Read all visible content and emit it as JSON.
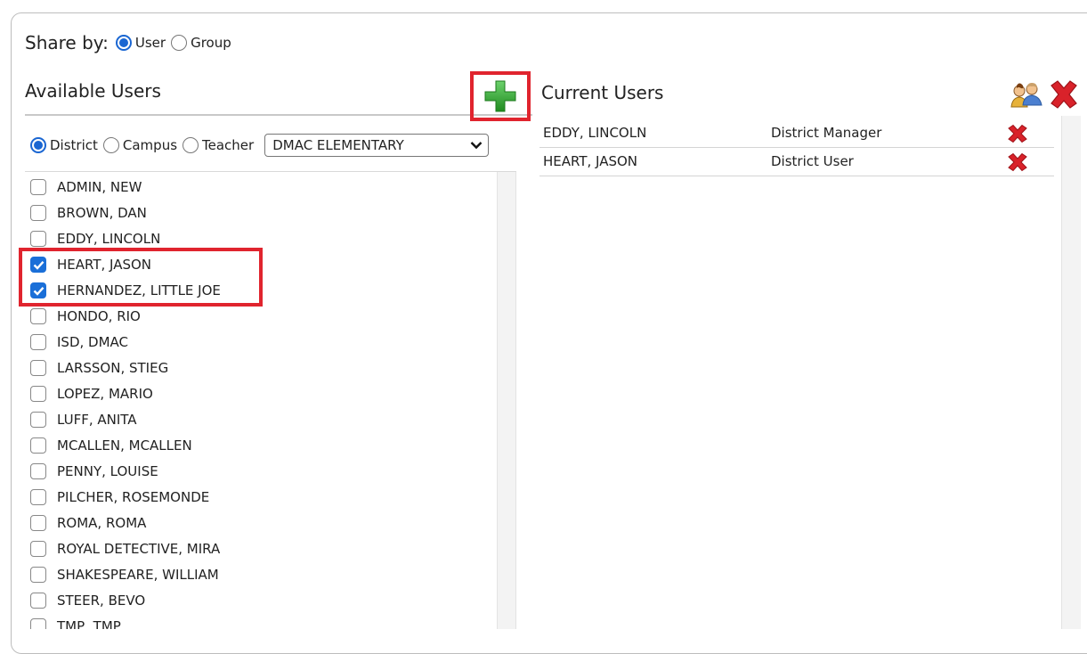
{
  "share": {
    "label": "Share by:",
    "options": [
      {
        "label": "User",
        "selected": true
      },
      {
        "label": "Group",
        "selected": false
      }
    ]
  },
  "available": {
    "title": "Available Users",
    "scope_options": [
      {
        "label": "District",
        "selected": true
      },
      {
        "label": "Campus",
        "selected": false
      },
      {
        "label": "Teacher",
        "selected": false
      }
    ],
    "campus_select_value": "DMAC ELEMENTARY",
    "users": [
      {
        "name": "ADMIN, NEW",
        "checked": false
      },
      {
        "name": "BROWN, DAN",
        "checked": false
      },
      {
        "name": "EDDY, LINCOLN",
        "checked": false
      },
      {
        "name": "HEART, JASON",
        "checked": true
      },
      {
        "name": "HERNANDEZ, LITTLE JOE",
        "checked": true
      },
      {
        "name": "HONDO, RIO",
        "checked": false
      },
      {
        "name": "ISD, DMAC",
        "checked": false
      },
      {
        "name": "LARSSON, STIEG",
        "checked": false
      },
      {
        "name": "LOPEZ, MARIO",
        "checked": false
      },
      {
        "name": "LUFF, ANITA",
        "checked": false
      },
      {
        "name": "MCALLEN, MCALLEN",
        "checked": false
      },
      {
        "name": "PENNY, LOUISE",
        "checked": false
      },
      {
        "name": "PILCHER, ROSEMONDE",
        "checked": false
      },
      {
        "name": "ROMA, ROMA",
        "checked": false
      },
      {
        "name": "ROYAL DETECTIVE, MIRA",
        "checked": false
      },
      {
        "name": "SHAKESPEARE, WILLIAM",
        "checked": false
      },
      {
        "name": "STEER, BEVO",
        "checked": false
      },
      {
        "name": "TMP, TMP",
        "checked": false
      }
    ]
  },
  "current": {
    "title": "Current Users",
    "rows": [
      {
        "name": "EDDY, LINCOLN",
        "role": "District Manager"
      },
      {
        "name": "HEART, JASON",
        "role": "District User"
      }
    ]
  },
  "icons": {
    "add": "plus-icon",
    "users": "users-icon",
    "remove": "red-x-icon",
    "dropdown": "chevron-down-icon"
  },
  "colors": {
    "accent_blue": "#1a66d2",
    "highlight_red": "#e0242e",
    "add_green": "#3aa63a",
    "remove_red": "#d9222a"
  }
}
